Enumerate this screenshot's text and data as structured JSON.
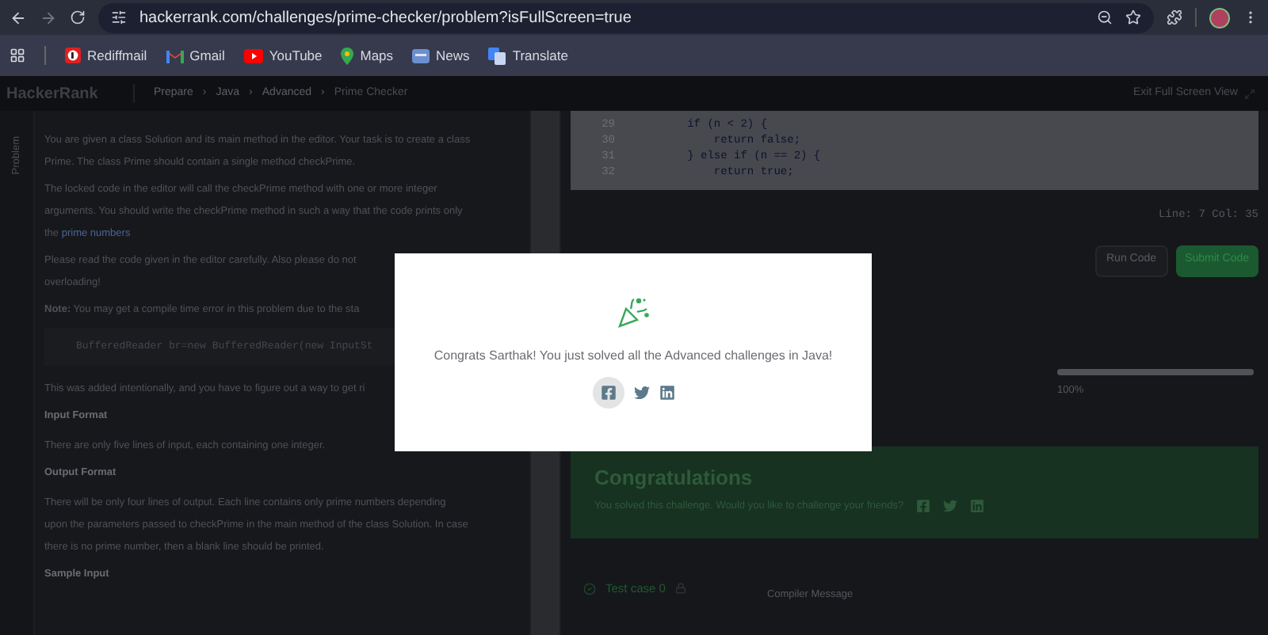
{
  "browser": {
    "url": "hackerrank.com/challenges/prime-checker/problem?isFullScreen=true",
    "bookmarks": [
      {
        "kind": "rediff",
        "label": "Rediffmail"
      },
      {
        "kind": "gmail",
        "label": "Gmail"
      },
      {
        "kind": "youtube",
        "label": "YouTube"
      },
      {
        "kind": "maps",
        "label": "Maps"
      },
      {
        "kind": "news",
        "label": "News"
      },
      {
        "kind": "translate",
        "label": "Translate"
      }
    ]
  },
  "header": {
    "logo": "HackerRank",
    "breadcrumbs": [
      "Prepare",
      "Java",
      "Advanced",
      "Prime Checker"
    ],
    "separator": "›",
    "exit_label": "Exit Full Screen View"
  },
  "sidebar_tabs": [
    {
      "label": "Problem",
      "selected": true
    }
  ],
  "problem": [
    {
      "kind": "paragraph",
      "lines": [
        "You are given a class Solution and its main method in the editor. Your task is to create a class",
        "Prime. The class Prime should contain a single method checkPrime."
      ]
    },
    {
      "kind": "paragraph",
      "lines": [
        "The locked code in the editor will call the checkPrime method with one or more integer",
        "arguments. You should write the checkPrime method in such a way that the code prints only",
        "the "
      ],
      "link": "prime numbers"
    },
    {
      "kind": "paragraph",
      "lines": [
        "Please read the code given in the editor carefully. Also please do not",
        "overloading!"
      ]
    },
    {
      "kind": "paragraph",
      "lines": [
        "**Note:** You may get a compile time error in this problem due to the sta"
      ]
    },
    {
      "kind": "code",
      "lines": [
        "BufferedReader br=new BufferedReader(new InputSt"
      ]
    },
    {
      "kind": "paragraph",
      "lines": [
        "This was added intentionally, and you have to figure out a way to get ri"
      ]
    },
    {
      "kind": "heading",
      "lines": [
        "Input Format"
      ]
    },
    {
      "kind": "paragraph",
      "lines": [
        "There are only five lines of input, each containing one integer."
      ]
    },
    {
      "kind": "heading",
      "lines": [
        "Output Format"
      ]
    },
    {
      "kind": "paragraph",
      "lines": [
        "There will be only four lines of output. Each line contains only prime numbers depending",
        "upon the parameters passed to checkPrime in the main method of the class Solution. In case",
        "there is no prime number, then a blank line should be printed."
      ]
    },
    {
      "kind": "heading",
      "lines": [
        "Sample Input"
      ]
    }
  ],
  "editor": {
    "lines": [
      {
        "number": "29",
        "text": "        if (n < 2) {"
      },
      {
        "number": "30",
        "text": "            return false;"
      },
      {
        "number": "31",
        "text": "        } else if (n == 2) {"
      },
      {
        "number": "32",
        "text": "            return true;"
      }
    ],
    "status": "Line: 7 Col: 35"
  },
  "buttons": [
    {
      "label": "Run Code",
      "kind": "secondary"
    },
    {
      "label": "Submit Code",
      "kind": "primary"
    }
  ],
  "progress": {
    "level": 1,
    "reading": "100%"
  },
  "congrats_card": {
    "title": "Congratulations",
    "text": "You solved this challenge. Would you like to challenge your friends?"
  },
  "test_case": {
    "label": "Test case 0",
    "message_label": "Compiler Message"
  },
  "modal": {
    "message": "Congrats Sarthak! You just solved all the Advanced challenges in Java!"
  }
}
